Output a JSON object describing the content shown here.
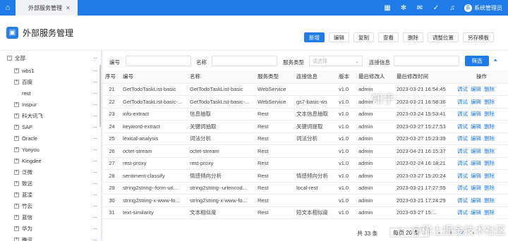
{
  "topbar": {
    "tab_label": "外部服务管理",
    "tab_close": "✕",
    "user_name": "系统管理员",
    "user_initial": "系"
  },
  "header": {
    "title": "外部服务管理",
    "buttons": [
      "新增",
      "编辑",
      "复制",
      "查看",
      "删除",
      "调整位置",
      "另存模板"
    ]
  },
  "tree": {
    "root": "全部",
    "items": [
      "wbs1",
      "百度",
      "rest",
      "Inspur",
      "科大讯飞",
      "SAP",
      "Oracle",
      "Yonyou",
      "Kingdee",
      "泛微",
      "致远",
      "蓝凌",
      "竹云",
      "蓝信",
      "华为",
      "腾讯"
    ]
  },
  "filters": {
    "code_label": "编号",
    "name_label": "名称",
    "type_label": "服务类型",
    "type_placeholder": "请选择",
    "conn_label": "连接信息",
    "search_button": "筛选"
  },
  "table": {
    "columns": [
      "序号",
      "编号",
      "名称",
      "服务类型",
      "连接信息",
      "版本",
      "最后修改人",
      "最后修改时间",
      "操作"
    ],
    "row_actions": [
      "调试",
      "编辑",
      "删除"
    ],
    "rows": [
      [
        "21",
        "GetTodoTaskList-basic",
        "GetTodoTaskList-basic",
        "WebService",
        "",
        "v1.0",
        "admin",
        "2023-03-21 16:54:45"
      ],
      [
        "22",
        "GetTodoTaskList-basic-...",
        "GetTodoTaskList-basic-...",
        "WebService",
        "gs7-basic-ws",
        "v1.0",
        "admin",
        "2023-03-21 16:58:36"
      ],
      [
        "23",
        "info-extract",
        "信息抽取",
        "Rest",
        "文本信息抽取",
        "v1.0",
        "admin",
        "2023-03-24 15:53:41"
      ],
      [
        "24",
        "keyword-extract",
        "关键词抽取",
        "Rest",
        "关键词提取",
        "v1.0",
        "admin",
        "2023-03-27 15:27:53"
      ],
      [
        "25",
        "lexical-analysis",
        "词法分析",
        "Rest",
        "词法分析",
        "v1.0",
        "admin",
        "2023-03-27 15:23:39"
      ],
      [
        "26",
        "octet-stream",
        "octet-stream",
        "Rest",
        "",
        "v1.0",
        "admin",
        "2023-04-21 16:15:37"
      ],
      [
        "27",
        "rest-proxy",
        "rest-proxy",
        "Rest",
        "",
        "v1.0",
        "admin",
        "2023-02-24 16:18:21"
      ],
      [
        "28",
        "sentiment-classify",
        "情感倾向分析",
        "Rest",
        "情感倾向分析",
        "v1.0",
        "admin",
        "2023-03-27 15:20:24"
      ],
      [
        "29",
        "string2string--form-url...",
        "string2string--urlencod...",
        "Rest",
        "local-rest",
        "v1.0",
        "admin",
        "2023-03-21 17:27:55"
      ],
      [
        "30",
        "string2string-x-www-fo...",
        "string2string-x-www-fo...",
        "Rest",
        "",
        "v1.0",
        "admin",
        "2023-03-21 17:24:29"
      ],
      [
        "31",
        "text-similarity",
        "文本相似度",
        "Rest",
        "短文本相似度",
        "v1.0",
        "admin",
        "2023-03-27 15:..."
      ]
    ]
  },
  "pagination": {
    "total": "共 33 条",
    "page_size": "每页 20 条",
    "pages": [
      "1",
      "2"
    ],
    "current": "2"
  },
  "watermark": {
    "zhihu": "知乎",
    "handle": "@稀土掘金技术社区"
  }
}
